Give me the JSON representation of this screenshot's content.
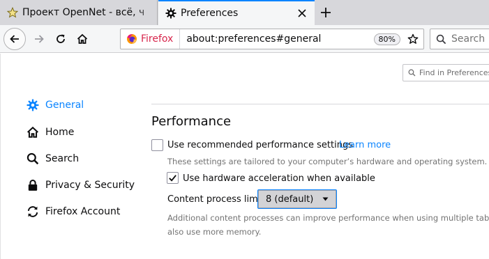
{
  "tabs": [
    {
      "title": "Проект OpenNet - всё, ч",
      "icon": "star-icon",
      "active": false
    },
    {
      "title": "Preferences",
      "icon": "gear-icon",
      "active": true
    }
  ],
  "navbar": {
    "identity_label": "Firefox",
    "url": "about:preferences#general",
    "zoom": "80%",
    "search_placeholder": "Search"
  },
  "content": {
    "find_placeholder": "Find in Preferences",
    "categories": [
      {
        "label": "General",
        "icon": "gear-icon",
        "selected": true
      },
      {
        "label": "Home",
        "icon": "home-icon",
        "selected": false
      },
      {
        "label": "Search",
        "icon": "search-icon",
        "selected": false
      },
      {
        "label": "Privacy & Security",
        "icon": "lock-icon",
        "selected": false
      },
      {
        "label": "Firefox Account",
        "icon": "sync-icon",
        "selected": false
      }
    ],
    "performance": {
      "title": "Performance",
      "recommended": {
        "label": "Use recommended performance settings",
        "checked": false,
        "learn_more": "Learn more",
        "description": "These settings are tailored to your computer’s hardware and operating system."
      },
      "hardware_accel": {
        "label": "Use hardware acceleration when available",
        "checked": true
      },
      "process_limit": {
        "label": "Content process limit",
        "value": "8 (default)",
        "description_line1": "Additional content processes can improve performance when using multiple tabs, b",
        "description_line2": "also use more memory."
      }
    }
  },
  "colors": {
    "accent": "#0a84ff",
    "firefox_red": "#d7264c",
    "tabstrip": "#d7d7db",
    "toolbar": "#f5f6f7"
  }
}
